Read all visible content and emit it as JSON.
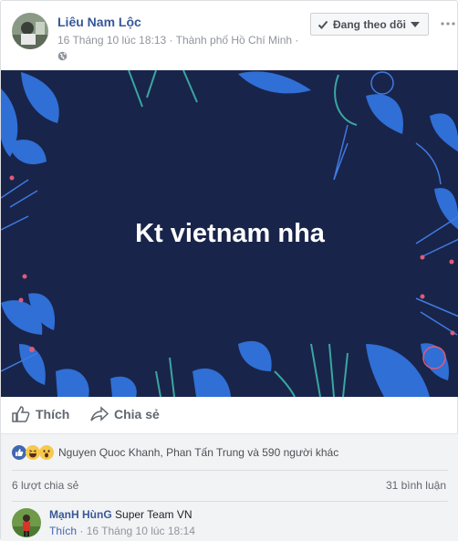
{
  "post": {
    "author": "Liêu Nam Lộc",
    "meta": "16 Tháng 10 lúc 18:13 · Thành phố Hồ Chí Minh ·",
    "follow_label": "Đang theo dõi",
    "banner_text": "Kt vietnam nha",
    "banner_color": "#19244a"
  },
  "actions": {
    "like_label": "Thích",
    "share_label": "Chia sẻ"
  },
  "reactions": {
    "icons": [
      "like-icon",
      "haha-icon",
      "wow-icon"
    ],
    "names": "Nguyen Quoc Khanh, Phan Tấn Trung và 590 người khác"
  },
  "stats": {
    "shares": "6 lượt chia sẻ",
    "comments": "31 bình luận"
  },
  "comment": {
    "author": "MạnH HùnG",
    "text": "Super Team VN",
    "like_label": "Thích",
    "time": "16 Tháng 10 lúc 18:14"
  },
  "colors": {
    "link": "#365899",
    "accent_blue": "#4267b2",
    "muted": "#90949c"
  }
}
